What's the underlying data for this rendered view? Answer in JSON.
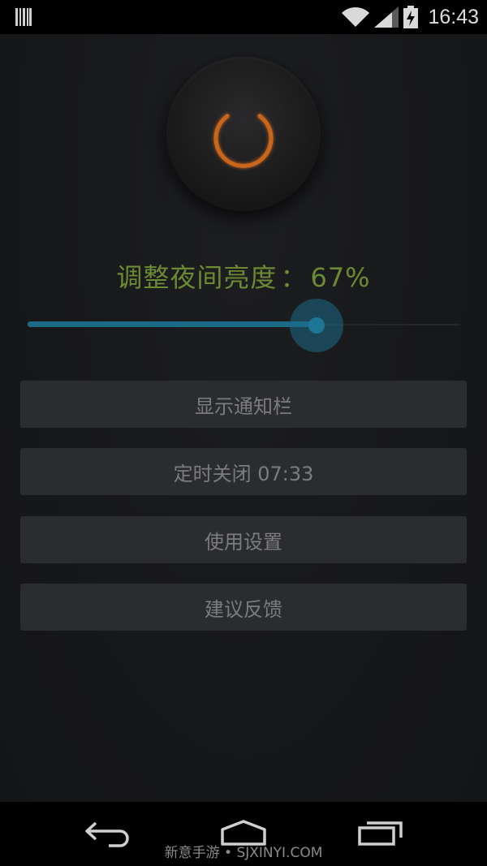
{
  "status_bar": {
    "time": "16:43",
    "left_icon": "barcode-notification-icon",
    "icons": [
      "wifi-icon",
      "signal-icon",
      "battery-charging-icon"
    ]
  },
  "power": {
    "icon": "power-icon",
    "color": "#c8661c"
  },
  "brightness": {
    "label": "调整夜间亮度",
    "separator": "：",
    "value_text": "67%",
    "level_percent": 67,
    "label_color": "#6c8a32",
    "accent_color": "#1b6a88"
  },
  "buttons": {
    "show_notification": "显示通知栏",
    "timer_close": "定时关闭 07:33",
    "usage_settings": "使用设置",
    "feedback": "建议反馈"
  },
  "nav_bar": {
    "icons": [
      "back-icon",
      "home-icon",
      "recent-apps-icon"
    ]
  },
  "watermark": "新意手游 • SJXINYI.COM"
}
